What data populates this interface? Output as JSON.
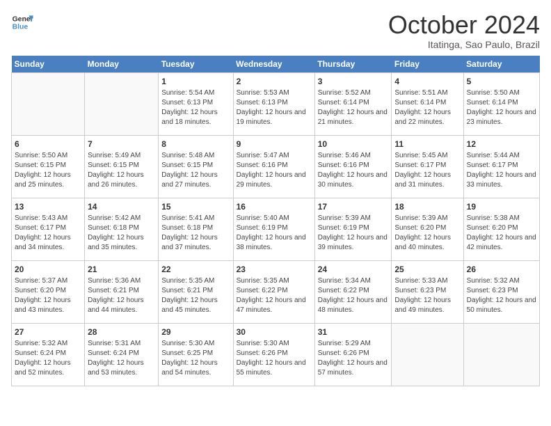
{
  "header": {
    "logo_line1": "General",
    "logo_line2": "Blue",
    "month": "October 2024",
    "location": "Itatinga, Sao Paulo, Brazil"
  },
  "days_of_week": [
    "Sunday",
    "Monday",
    "Tuesday",
    "Wednesday",
    "Thursday",
    "Friday",
    "Saturday"
  ],
  "weeks": [
    [
      {
        "day": "",
        "empty": true
      },
      {
        "day": "",
        "empty": true
      },
      {
        "day": "1",
        "sunrise": "Sunrise: 5:54 AM",
        "sunset": "Sunset: 6:13 PM",
        "daylight": "Daylight: 12 hours and 18 minutes."
      },
      {
        "day": "2",
        "sunrise": "Sunrise: 5:53 AM",
        "sunset": "Sunset: 6:13 PM",
        "daylight": "Daylight: 12 hours and 19 minutes."
      },
      {
        "day": "3",
        "sunrise": "Sunrise: 5:52 AM",
        "sunset": "Sunset: 6:14 PM",
        "daylight": "Daylight: 12 hours and 21 minutes."
      },
      {
        "day": "4",
        "sunrise": "Sunrise: 5:51 AM",
        "sunset": "Sunset: 6:14 PM",
        "daylight": "Daylight: 12 hours and 22 minutes."
      },
      {
        "day": "5",
        "sunrise": "Sunrise: 5:50 AM",
        "sunset": "Sunset: 6:14 PM",
        "daylight": "Daylight: 12 hours and 23 minutes."
      }
    ],
    [
      {
        "day": "6",
        "sunrise": "Sunrise: 5:50 AM",
        "sunset": "Sunset: 6:15 PM",
        "daylight": "Daylight: 12 hours and 25 minutes."
      },
      {
        "day": "7",
        "sunrise": "Sunrise: 5:49 AM",
        "sunset": "Sunset: 6:15 PM",
        "daylight": "Daylight: 12 hours and 26 minutes."
      },
      {
        "day": "8",
        "sunrise": "Sunrise: 5:48 AM",
        "sunset": "Sunset: 6:15 PM",
        "daylight": "Daylight: 12 hours and 27 minutes."
      },
      {
        "day": "9",
        "sunrise": "Sunrise: 5:47 AM",
        "sunset": "Sunset: 6:16 PM",
        "daylight": "Daylight: 12 hours and 29 minutes."
      },
      {
        "day": "10",
        "sunrise": "Sunrise: 5:46 AM",
        "sunset": "Sunset: 6:16 PM",
        "daylight": "Daylight: 12 hours and 30 minutes."
      },
      {
        "day": "11",
        "sunrise": "Sunrise: 5:45 AM",
        "sunset": "Sunset: 6:17 PM",
        "daylight": "Daylight: 12 hours and 31 minutes."
      },
      {
        "day": "12",
        "sunrise": "Sunrise: 5:44 AM",
        "sunset": "Sunset: 6:17 PM",
        "daylight": "Daylight: 12 hours and 33 minutes."
      }
    ],
    [
      {
        "day": "13",
        "sunrise": "Sunrise: 5:43 AM",
        "sunset": "Sunset: 6:17 PM",
        "daylight": "Daylight: 12 hours and 34 minutes."
      },
      {
        "day": "14",
        "sunrise": "Sunrise: 5:42 AM",
        "sunset": "Sunset: 6:18 PM",
        "daylight": "Daylight: 12 hours and 35 minutes."
      },
      {
        "day": "15",
        "sunrise": "Sunrise: 5:41 AM",
        "sunset": "Sunset: 6:18 PM",
        "daylight": "Daylight: 12 hours and 37 minutes."
      },
      {
        "day": "16",
        "sunrise": "Sunrise: 5:40 AM",
        "sunset": "Sunset: 6:19 PM",
        "daylight": "Daylight: 12 hours and 38 minutes."
      },
      {
        "day": "17",
        "sunrise": "Sunrise: 5:39 AM",
        "sunset": "Sunset: 6:19 PM",
        "daylight": "Daylight: 12 hours and 39 minutes."
      },
      {
        "day": "18",
        "sunrise": "Sunrise: 5:39 AM",
        "sunset": "Sunset: 6:20 PM",
        "daylight": "Daylight: 12 hours and 40 minutes."
      },
      {
        "day": "19",
        "sunrise": "Sunrise: 5:38 AM",
        "sunset": "Sunset: 6:20 PM",
        "daylight": "Daylight: 12 hours and 42 minutes."
      }
    ],
    [
      {
        "day": "20",
        "sunrise": "Sunrise: 5:37 AM",
        "sunset": "Sunset: 6:20 PM",
        "daylight": "Daylight: 12 hours and 43 minutes."
      },
      {
        "day": "21",
        "sunrise": "Sunrise: 5:36 AM",
        "sunset": "Sunset: 6:21 PM",
        "daylight": "Daylight: 12 hours and 44 minutes."
      },
      {
        "day": "22",
        "sunrise": "Sunrise: 5:35 AM",
        "sunset": "Sunset: 6:21 PM",
        "daylight": "Daylight: 12 hours and 45 minutes."
      },
      {
        "day": "23",
        "sunrise": "Sunrise: 5:35 AM",
        "sunset": "Sunset: 6:22 PM",
        "daylight": "Daylight: 12 hours and 47 minutes."
      },
      {
        "day": "24",
        "sunrise": "Sunrise: 5:34 AM",
        "sunset": "Sunset: 6:22 PM",
        "daylight": "Daylight: 12 hours and 48 minutes."
      },
      {
        "day": "25",
        "sunrise": "Sunrise: 5:33 AM",
        "sunset": "Sunset: 6:23 PM",
        "daylight": "Daylight: 12 hours and 49 minutes."
      },
      {
        "day": "26",
        "sunrise": "Sunrise: 5:32 AM",
        "sunset": "Sunset: 6:23 PM",
        "daylight": "Daylight: 12 hours and 50 minutes."
      }
    ],
    [
      {
        "day": "27",
        "sunrise": "Sunrise: 5:32 AM",
        "sunset": "Sunset: 6:24 PM",
        "daylight": "Daylight: 12 hours and 52 minutes."
      },
      {
        "day": "28",
        "sunrise": "Sunrise: 5:31 AM",
        "sunset": "Sunset: 6:24 PM",
        "daylight": "Daylight: 12 hours and 53 minutes."
      },
      {
        "day": "29",
        "sunrise": "Sunrise: 5:30 AM",
        "sunset": "Sunset: 6:25 PM",
        "daylight": "Daylight: 12 hours and 54 minutes."
      },
      {
        "day": "30",
        "sunrise": "Sunrise: 5:30 AM",
        "sunset": "Sunset: 6:26 PM",
        "daylight": "Daylight: 12 hours and 55 minutes."
      },
      {
        "day": "31",
        "sunrise": "Sunrise: 5:29 AM",
        "sunset": "Sunset: 6:26 PM",
        "daylight": "Daylight: 12 hours and 57 minutes."
      },
      {
        "day": "",
        "empty": true
      },
      {
        "day": "",
        "empty": true
      }
    ]
  ]
}
